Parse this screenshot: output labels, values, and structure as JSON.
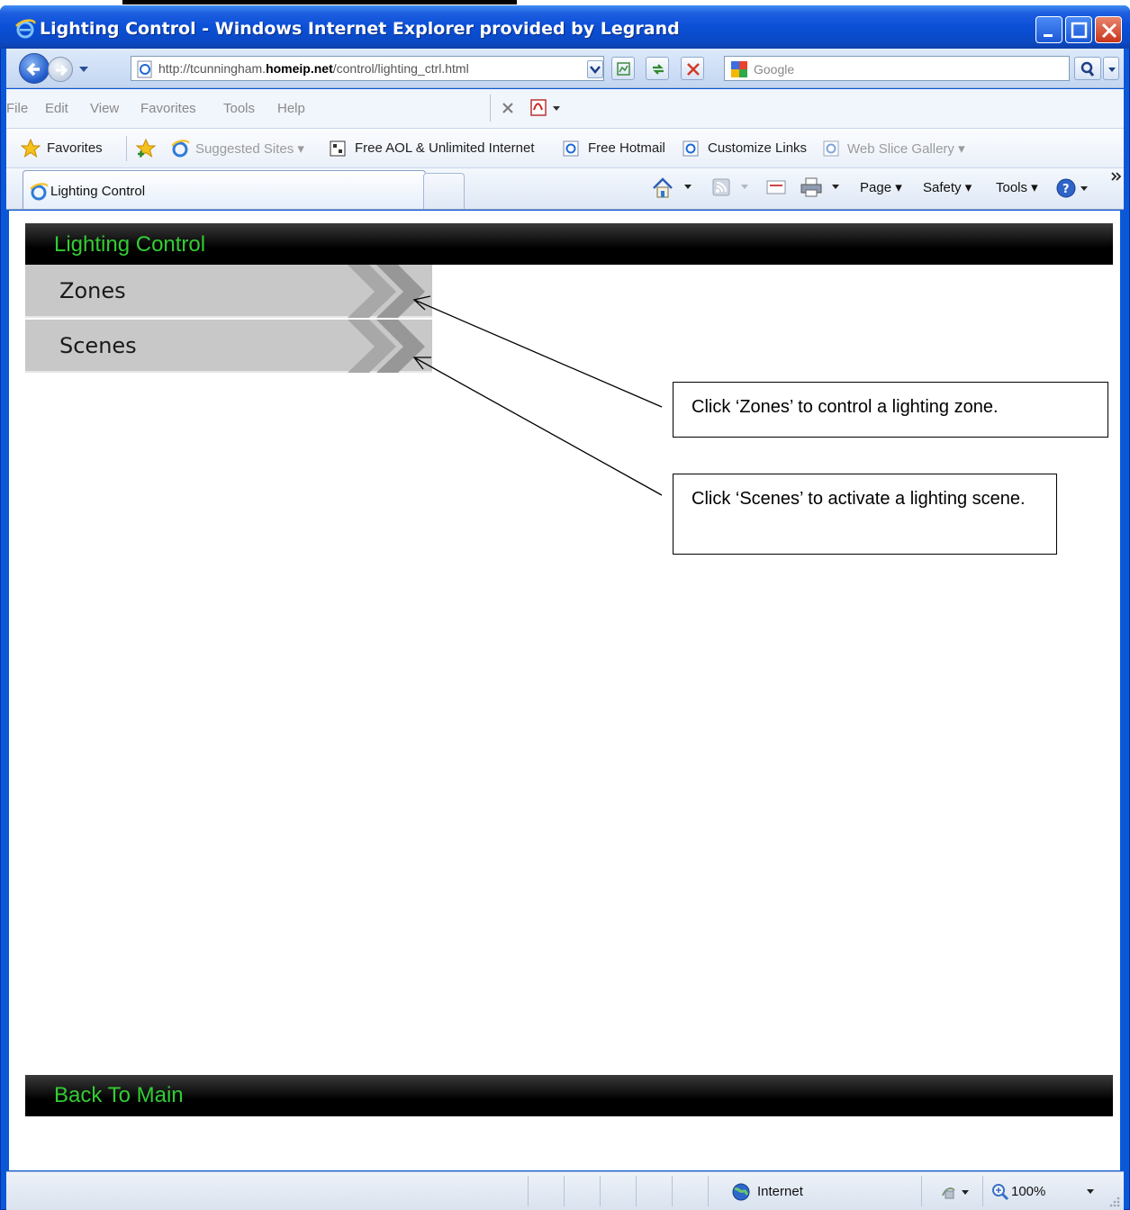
{
  "window": {
    "title": "Lighting Control - Windows Internet Explorer provided by Legrand"
  },
  "address_bar": {
    "url_prefix": "http://tcunningham.",
    "url_domain": "homeip.net",
    "url_path": "/control/lighting_ctrl.html",
    "search_placeholder": "Google"
  },
  "menu": {
    "items": [
      "File",
      "Edit",
      "View",
      "Favorites",
      "Tools",
      "Help"
    ]
  },
  "favorites_bar": {
    "favorites_label": "Favorites",
    "items": [
      {
        "label": "Suggested Sites ▾",
        "dim": true
      },
      {
        "label": "Free AOL & Unlimited Internet",
        "dim": false
      },
      {
        "label": "Free Hotmail",
        "dim": false
      },
      {
        "label": "Customize Links",
        "dim": false
      },
      {
        "label": "Web Slice Gallery ▾",
        "dim": true
      }
    ]
  },
  "tabs": {
    "active_label": "Lighting Control"
  },
  "command_bar": {
    "page": "Page ▾",
    "safety": "Safety ▾",
    "tools": "Tools ▾"
  },
  "page": {
    "header_title": "Lighting Control",
    "nav_buttons": [
      "Zones",
      "Scenes"
    ],
    "footer_link": "Back To Main"
  },
  "callouts": {
    "zones": "Click ‘Zones’ to control a lighting  zone.",
    "scenes": "Click ‘Scenes’ to activate a lighting scene."
  },
  "status_bar": {
    "zone": "Internet",
    "zoom": "100%"
  },
  "colors": {
    "header_text": "#33cc33",
    "titlebar": "#0a4fd6",
    "nav_button_bg": "#c8c8c8"
  }
}
